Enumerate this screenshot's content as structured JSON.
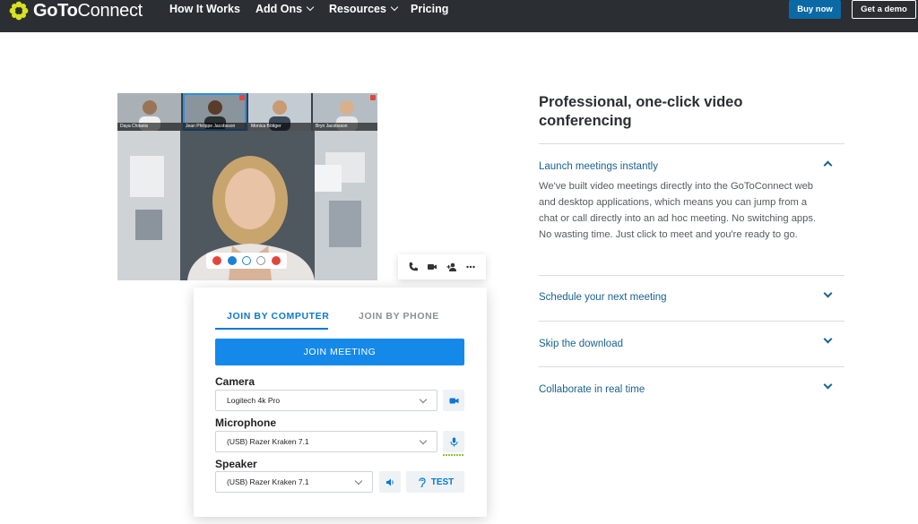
{
  "nav": {
    "brand_goto": "GoTo",
    "brand_connect": "Connect",
    "items": [
      {
        "label": "How It Works"
      },
      {
        "label": "Add Ons"
      },
      {
        "label": "Resources"
      },
      {
        "label": "Pricing"
      }
    ],
    "buy_label": "Buy now",
    "demo_label": "Get a demo",
    "colors": {
      "bar": "#2b2e33",
      "buy": "#0b6aa6",
      "logo": "#d6e31f"
    }
  },
  "video": {
    "participants": [
      {
        "name": "Daya Chitanis"
      },
      {
        "name": "Jean Philippe Jacobsson"
      },
      {
        "name": "Monica Böttger"
      },
      {
        "name": "Bryn Jacobsson"
      }
    ],
    "controls": [
      "mute-icon",
      "video-icon",
      "chat-icon",
      "add-icon",
      "hangup-icon"
    ]
  },
  "mini_toolbar": [
    "phone-icon",
    "camera-icon",
    "add-person-icon",
    "more-icon"
  ],
  "join": {
    "tab_computer": "JOIN BY COMPUTER",
    "tab_phone": "JOIN BY PHONE",
    "join_button": "JOIN MEETING",
    "camera_label": "Camera",
    "camera_value": "Logitech 4k Pro",
    "microphone_label": "Microphone",
    "microphone_value": "(USB) Razer Kraken 7.1",
    "speaker_label": "Speaker",
    "speaker_value": "(USB) Razer Kraken 7.1",
    "test_label": "TEST",
    "colors": {
      "accent": "#0a78d2",
      "button": "#1589ea"
    }
  },
  "feature": {
    "heading": "Professional, one-click video conferencing",
    "accordion": [
      {
        "title": "Launch meetings instantly",
        "expanded": true,
        "body": "We've built video meetings directly into the GoToConnect web and desktop applications, which means you can jump from a chat or call directly into an ad hoc meeting. No switching apps. No wasting time. Just click to meet and you're ready to go."
      },
      {
        "title": "Schedule your next meeting",
        "expanded": false
      },
      {
        "title": "Skip the download",
        "expanded": false
      },
      {
        "title": "Collaborate in real time",
        "expanded": false
      }
    ],
    "colors": {
      "link": "#19628f"
    }
  }
}
